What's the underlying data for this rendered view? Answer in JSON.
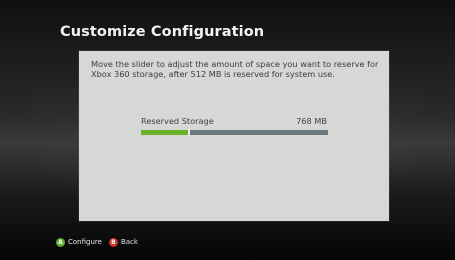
{
  "screen": {
    "title": "Customize Configuration"
  },
  "panel": {
    "description": "Move the slider to adjust the amount of space you want to reserve for Xbox 360 storage, after 512 MB is reserved for system use."
  },
  "slider": {
    "label": "Reserved Storage",
    "value_text": "768 MB",
    "fill_fraction": 0.255
  },
  "footer": {
    "items": [
      {
        "glyph": "A",
        "label": "Configure",
        "color": "#5fae2e",
        "icon": "a-button-icon"
      },
      {
        "glyph": "B",
        "label": "Back",
        "color": "#c8322b",
        "icon": "b-button-icon"
      }
    ]
  },
  "colors": {
    "accent": "#6bb42a",
    "track": "#6f7a80",
    "panel": "#d6d8d6"
  }
}
